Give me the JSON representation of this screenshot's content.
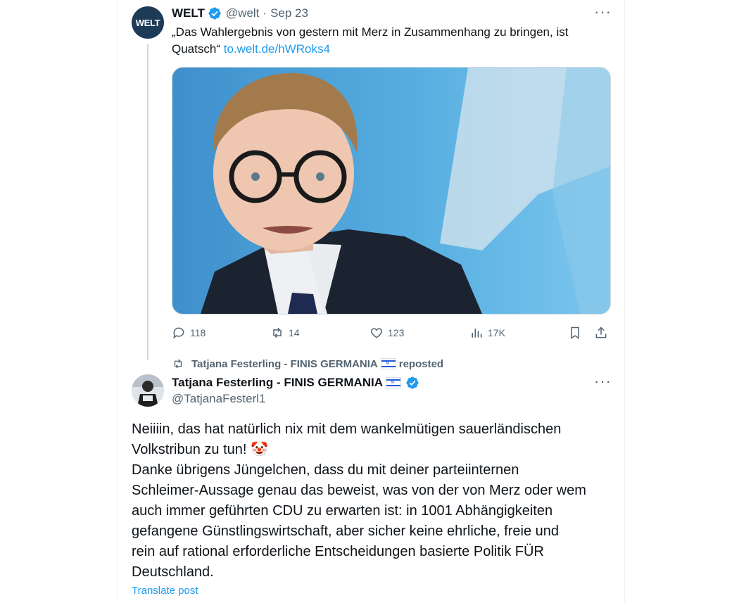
{
  "welt_post": {
    "avatar_text": "WELT",
    "name": "WELT",
    "handle": "@welt",
    "separator": "·",
    "date": "Sep 23",
    "more": "···",
    "text": "„Das Wahlergebnis von gestern mit Merz in Zusammenhang zu bringen, ist Quatsch“",
    "link": "to.welt.de/hWRoks4",
    "actions": {
      "replies": "118",
      "reposts": "14",
      "likes": "123",
      "views": "17K"
    }
  },
  "repost_context": {
    "text": "Tatjana Festerling - FINIS GERMANIA",
    "suffix": "reposted"
  },
  "tf_post": {
    "name": "Tatjana Festerling - FINIS GERMANIA",
    "handle": "@TatjanaFesterl1",
    "more": "···",
    "text": "Neiiiin, das hat natürlich nix mit dem wankelmütigen sauerländischen\nVolkstribun zu tun! 🤡\nDanke übrigens Jüngelchen, dass du mit deiner parteiinternen\nSchleimer-Aussage genau das beweist, was von der von Merz oder wem\nauch immer geführten CDU zu erwarten ist: in 1001 Abhängigkeiten\ngefangene Günstlingswirtschaft, aber sicher keine ehrliche, freie und\nrein auf rational erforderliche Entscheidungen basierte Politik FÜR\nDeutschland.",
    "translate": "Translate post"
  },
  "colors": {
    "accent": "#1d9bf0",
    "muted": "#536471",
    "text": "#0f1419",
    "welt_avatar": "#1d3a56"
  }
}
